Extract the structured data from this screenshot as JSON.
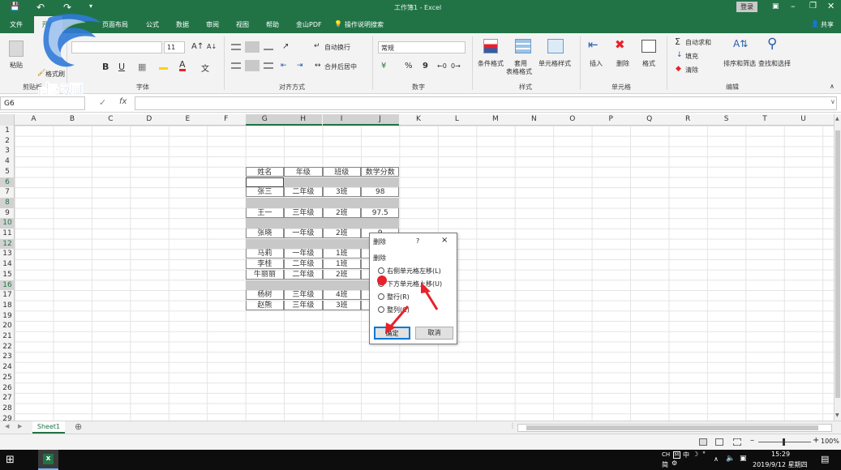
{
  "window": {
    "title": "工作簿1 - Excel",
    "login_label": "登录",
    "share_label": "共享"
  },
  "menu": {
    "file": "文件",
    "home": "开始",
    "page_layout": "页面布局",
    "formulas": "公式",
    "data": "数据",
    "review": "审阅",
    "view": "视图",
    "help": "帮助",
    "wps_pdf": "金山PDF",
    "tell_me": "操作说明搜索"
  },
  "ribbon": {
    "paste": "粘贴",
    "format_brush": "格式刷",
    "clipboard": "剪贴板",
    "font_size": "11",
    "bold": "B",
    "italic": "I",
    "underline": "U",
    "font_group": "字体",
    "wrap_text": "自动换行",
    "merge_center": "合并后居中",
    "alignment_group": "对齐方式",
    "number_format": "常规",
    "percent": "%",
    "comma": "9",
    "number_group": "数字",
    "conditional_format": "条件格式",
    "table_format_1": "套用",
    "table_format_2": "表格格式",
    "cell_styles": "单元格样式",
    "styles_group": "样式",
    "insert": "插入",
    "delete": "删除",
    "format": "格式",
    "cells_group": "单元格",
    "autosum": "自动求和",
    "fill": "填充",
    "clear": "清除",
    "sort_filter": "排序和筛选",
    "find_select": "查找和选择",
    "editing_group": "编辑"
  },
  "watermark": {
    "text": "虎观"
  },
  "formula_bar": {
    "name_box": "G6",
    "fx": "fx",
    "content": ""
  },
  "grid": {
    "columns": [
      "A",
      "B",
      "C",
      "D",
      "E",
      "F",
      "G",
      "H",
      "I",
      "J",
      "K",
      "L",
      "M",
      "N",
      "O",
      "P",
      "Q",
      "R",
      "S",
      "T",
      "U"
    ],
    "rows": [
      "1",
      "2",
      "3",
      "4",
      "5",
      "6",
      "7",
      "8",
      "9",
      "10",
      "11",
      "12",
      "13",
      "14",
      "15",
      "16",
      "17",
      "18",
      "19",
      "20",
      "21",
      "22",
      "23",
      "24",
      "25",
      "26",
      "27",
      "28",
      "29"
    ],
    "selected_columns": [
      "G",
      "H",
      "I",
      "J"
    ],
    "selected_rows": [
      "6",
      "8",
      "10",
      "12",
      "16"
    ],
    "table": {
      "headers": [
        "姓名",
        "年级",
        "班级",
        "数学分数"
      ],
      "rows": [
        {
          "row": "7",
          "values": [
            "张三",
            "二年级",
            "3班",
            "98"
          ]
        },
        {
          "row": "9",
          "values": [
            "王一",
            "三年级",
            "2班",
            "97.5"
          ]
        },
        {
          "row": "11",
          "values": [
            "张晓",
            "一年级",
            "2班",
            "9"
          ]
        },
        {
          "row": "13",
          "values": [
            "马莉",
            "一年级",
            "1班",
            ""
          ]
        },
        {
          "row": "14",
          "values": [
            "李桂",
            "二年级",
            "1班",
            ""
          ]
        },
        {
          "row": "15",
          "values": [
            "牛丽丽",
            "二年级",
            "2班",
            ""
          ]
        },
        {
          "row": "17",
          "values": [
            "杨树",
            "三年级",
            "4班",
            ""
          ]
        },
        {
          "row": "18",
          "values": [
            "赵熊",
            "三年级",
            "3班",
            ""
          ]
        }
      ]
    }
  },
  "dialog": {
    "title": "删除",
    "help": "?",
    "close": "×",
    "group_label": "删除",
    "options": [
      {
        "label": "右侧单元格左移(L)",
        "checked": false
      },
      {
        "label": "下方单元格上移(U)",
        "checked": true
      },
      {
        "label": "整行(R)",
        "checked": false
      },
      {
        "label": "整列(C)",
        "checked": false
      }
    ],
    "ok": "确定",
    "cancel": "取消"
  },
  "sheets": {
    "active": "Sheet1"
  },
  "status": {
    "zoom": "100%"
  },
  "taskbar": {
    "ime_line1": "CH",
    "ime_mode": "中",
    "ime_simplified": "简",
    "time": "15:29",
    "date": "2019/9/12 星期四"
  },
  "colors": {
    "excel_green": "#217346",
    "selection_gray": "#c8c8c8",
    "annotation_red": "#e8212b"
  }
}
